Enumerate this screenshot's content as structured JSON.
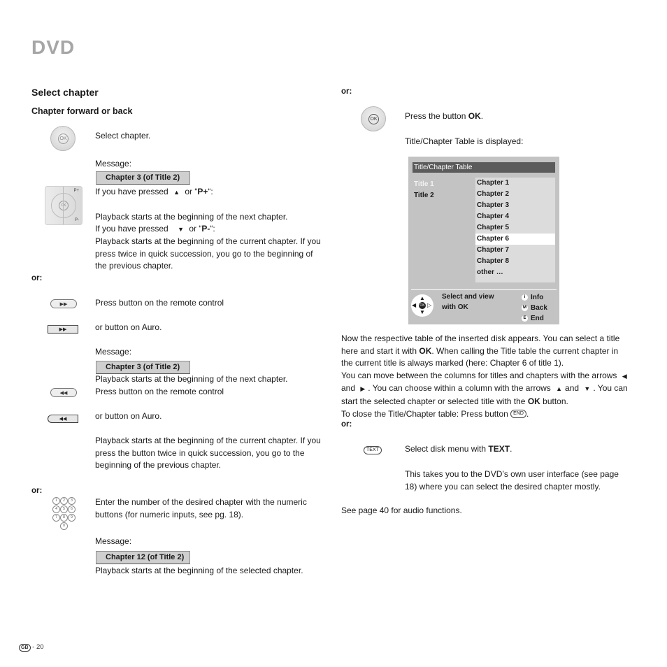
{
  "header": {
    "title": "DVD"
  },
  "left": {
    "section_title": "Select chapter",
    "subsection_title": "Chapter forward or back",
    "select_chapter": "Select chapter.",
    "message_label": "Message:",
    "message_1": "Chapter 3 (of Title 2)",
    "if_pressed_up": "If you have pressed",
    "or_p_plus_pre": "or “",
    "p_plus": "P+",
    "or_p_plus_post": "“:",
    "next_chapter": "Playback starts at the beginning of the next chapter.",
    "if_pressed_down": "If you have pressed",
    "or_p_minus_pre": "or “",
    "p_minus": "P-",
    "or_p_minus_post": "“:",
    "current_chapter_para": "Playback starts at the beginning of the current chapter. If you press twice in quick succession, you go to the beginning of the previous chapter.",
    "or_1": "or:",
    "press_remote_ff": "Press button on the remote control",
    "button_auro_ff": "or button on Auro.",
    "message_2_label": "Message:",
    "message_2": "Chapter 3 (of Title 2)",
    "next_chapter_2": "Playback starts at the beginning of the next chapter.",
    "press_remote_rw": "Press button on the remote control",
    "button_auro_rw": "or button on Auro.",
    "current_chapter_para_2": "Playback starts at the beginning of the current chapter. If you press the button twice in quick succession, you go to the beginning of the previous chapter.",
    "or_2": "or:",
    "numeric_para": "Enter the number of the desired chapter with the numeric buttons (for numeric inputs, see pg. 18).",
    "message_3_label": "Message:",
    "message_3": "Chapter 12 (of Title 2)",
    "selected_chapter": "Playback starts at the beginning of the selected chapter.",
    "numpad_keys": [
      "1",
      "2",
      "3",
      "4",
      "5",
      "6",
      "7",
      "8",
      "9",
      "0"
    ]
  },
  "right": {
    "or_top": "or:",
    "press_ok_pre": "Press the button ",
    "press_ok_bold": "OK",
    "press_ok_post": ".",
    "table_displayed": "Title/Chapter Table is displayed:",
    "screen": {
      "header": "Title/Chapter Table",
      "titles": [
        {
          "label": "Title 1",
          "highlighted": true
        },
        {
          "label": "Title 2",
          "highlighted": false
        }
      ],
      "chapters": [
        "Chapter 1",
        "Chapter 2",
        "Chapter 3",
        "Chapter 4",
        "Chapter 5",
        "Chapter 6",
        "Chapter 7",
        "Chapter 8",
        "other …"
      ],
      "selected_chapter_index": 5,
      "footer_hint_line1": "Select and view",
      "footer_hint_line2": "with OK",
      "footer_keys": [
        {
          "key": "i",
          "label": "Info"
        },
        {
          "key": "M",
          "label": "Back"
        },
        {
          "key": "E",
          "label": "End"
        }
      ]
    },
    "para1_a": "Now the respective table of the inserted disk appears. You can select a title here and start it with ",
    "para1_ok": "OK",
    "para1_b": ". When calling the Title table the current chapter in the current title is always marked (here: Chapter 6 of title 1).",
    "para2_a": "You can move between the columns for titles and chapters with the arrows",
    "para2_and1": "and",
    "para2_b": ". You can choose within a column with the arrows",
    "para2_and2": "and",
    "para2_c": ". You can start the selected chapter or selected title with the ",
    "para2_ok": "OK",
    "para2_d": " button.",
    "close_pre": "To close the Title/Chapter table: Press button",
    "end_key": "END",
    "close_post": ".",
    "or_mid": "or:",
    "text_key": "TEXT",
    "select_disk_pre": "Select disk menu with ",
    "select_disk_bold": "TEXT",
    "select_disk_post": ".",
    "dvd_ui_para": "This takes you to the DVD’s own user interface (see page 18) where you can select the desired chapter mostly.",
    "see_page": "See page 40 for audio functions."
  },
  "footer": {
    "country_badge": "GB",
    "page_number": "- 20"
  }
}
